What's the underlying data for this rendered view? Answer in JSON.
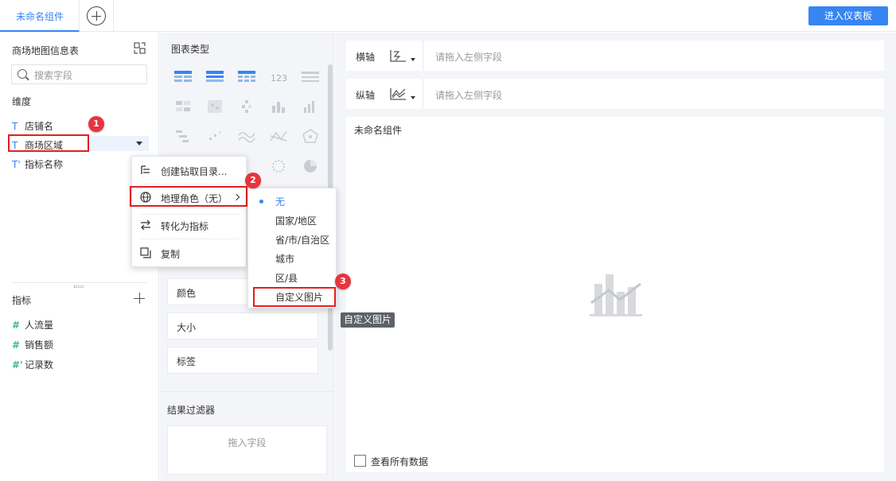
{
  "tabs": {
    "active_label": "未命名组件"
  },
  "header": {
    "enter_dashboard_label": "进入仪表板"
  },
  "left_panel": {
    "dataset_title": "商场地图信息表",
    "search_placeholder": "搜索字段",
    "dimensions_label": "维度",
    "dimensions": [
      {
        "type_glyph": "T",
        "label": "店铺名"
      },
      {
        "type_glyph": "T",
        "label": "商场区域"
      },
      {
        "type_glyph": "T'",
        "label": "指标名称"
      }
    ],
    "measures_label": "指标",
    "measures": [
      {
        "type_glyph": "#",
        "label": "人流量"
      },
      {
        "type_glyph": "#",
        "label": "销售额"
      },
      {
        "type_glyph": "#'",
        "label": "记录数"
      }
    ]
  },
  "middle_panel": {
    "chart_type_title": "图表类型",
    "props": [
      "颜色",
      "大小",
      "标签"
    ],
    "result_filter_title": "结果过滤器",
    "drop_field_hint": "拖入字段"
  },
  "right_panel": {
    "x_axis_label": "横轴",
    "y_axis_label": "纵轴",
    "axis_placeholder": "请拖入左侧字段",
    "canvas_title": "未命名组件",
    "show_all_data_label": "查看所有数据"
  },
  "context_menu": {
    "items": [
      {
        "icon": "drill-directory-icon",
        "label": "创建钻取目录..."
      },
      {
        "icon": "globe-icon",
        "label": "地理角色（无）"
      },
      {
        "icon": "swap-arrows-icon",
        "label": "转化为指标"
      },
      {
        "icon": "copy-icon",
        "label": "复制"
      }
    ]
  },
  "geo_submenu": {
    "items": [
      "无",
      "国家/地区",
      "省/市/自治区",
      "城市",
      "区/县",
      "自定义图片"
    ],
    "selected_index": 0
  },
  "tooltip": {
    "text": "自定义图片"
  },
  "annotations": {
    "badges": [
      "1",
      "2",
      "3"
    ]
  },
  "colors": {
    "accent": "#3685f2",
    "highlight_border": "#e02020",
    "badge": "#e7343f",
    "measure": "#35b8a5"
  }
}
